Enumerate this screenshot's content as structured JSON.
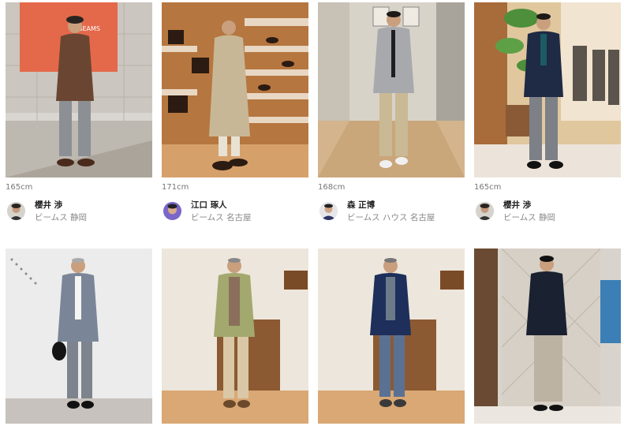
{
  "snaps": [
    {
      "height": "165cm",
      "name": "櫻井 渉",
      "shop": "ビームス 静岡"
    },
    {
      "height": "171cm",
      "name": "江口 琢人",
      "shop": "ビームス 名古屋"
    },
    {
      "height": "168cm",
      "name": "森 正博",
      "shop": "ビームス ハウス 名古屋"
    },
    {
      "height": "165cm",
      "name": "櫻井 渉",
      "shop": "ビームス 静岡"
    }
  ],
  "sign_text": "BEAMS"
}
